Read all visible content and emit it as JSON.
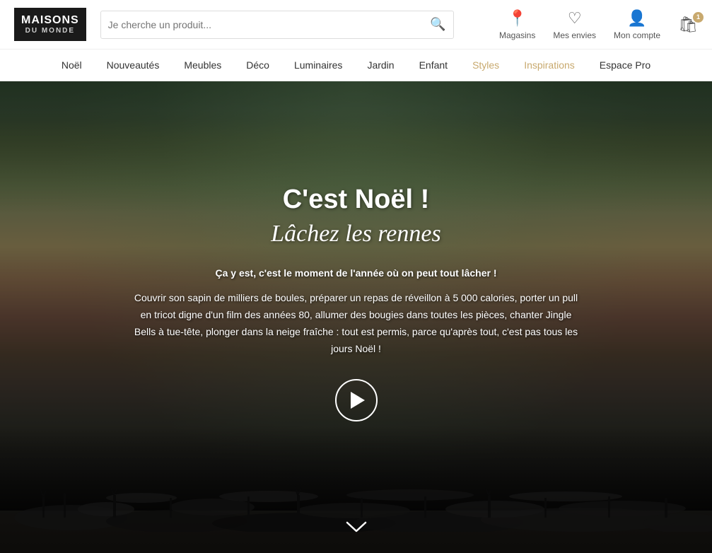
{
  "logo": {
    "main": "MAISONS",
    "sub": "DU MONDE"
  },
  "search": {
    "placeholder": "Je cherche un produit...",
    "icon": "🔍"
  },
  "header_actions": [
    {
      "id": "stores",
      "icon": "📍",
      "label": "Magasins"
    },
    {
      "id": "wishlist",
      "icon": "♡",
      "label": "Mes envies"
    },
    {
      "id": "account",
      "icon": "👤",
      "label": "Mon compte"
    },
    {
      "id": "cart",
      "icon": "🛍",
      "label": "",
      "badge": "1"
    }
  ],
  "nav": {
    "items": [
      {
        "id": "noel",
        "label": "Noël",
        "active": false
      },
      {
        "id": "nouveautes",
        "label": "Nouveautés",
        "active": false
      },
      {
        "id": "meubles",
        "label": "Meubles",
        "active": false
      },
      {
        "id": "deco",
        "label": "Déco",
        "active": false
      },
      {
        "id": "luminaires",
        "label": "Luminaires",
        "active": false
      },
      {
        "id": "jardin",
        "label": "Jardin",
        "active": false
      },
      {
        "id": "enfant",
        "label": "Enfant",
        "active": false
      },
      {
        "id": "styles",
        "label": "Styles",
        "active": true
      },
      {
        "id": "inspirations",
        "label": "Inspirations",
        "active": false,
        "highlight": true
      },
      {
        "id": "espace-pro",
        "label": "Espace Pro",
        "active": false
      }
    ]
  },
  "hero": {
    "title": "C'est Noël !",
    "subtitle": "Lâchez les rennes",
    "lead": "Ça y est, c'est le moment de l'année où on peut tout lâcher !",
    "body": "Couvrir son sapin de milliers de boules, préparer un repas de réveillon à 5 000 calories, porter un pull en tricot digne d'un film des années 80, allumer des bougies dans toutes les pièces, chanter Jingle Bells à tue-tête, plonger dans la neige fraîche : tout est permis, parce qu'après tout, c'est pas tous les jours Noël !",
    "play_button_label": "▶",
    "scroll_icon": "∨"
  }
}
